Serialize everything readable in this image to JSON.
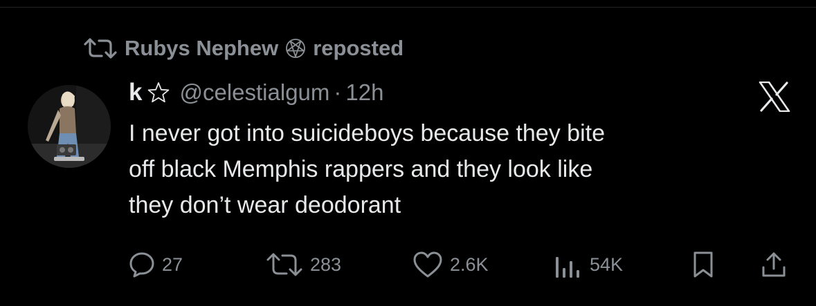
{
  "repost": {
    "reposter": "Rubys Nephew",
    "label": "reposted"
  },
  "tweet": {
    "display_name": "k",
    "handle": "@celestialgum",
    "separator": "·",
    "time": "12h",
    "lines": [
      "I never got into suicideboys because they bite",
      "off black Memphis rappers and they look like",
      "they don’t wear deodorant"
    ]
  },
  "actions": {
    "replies": "27",
    "reposts": "283",
    "likes": "2.6K",
    "views": "54K"
  },
  "icons": {
    "repost_indicator": "repost-icon",
    "pentagram": "inverted-pentagram-icon",
    "name_badge": "star-outline-icon",
    "brand": "x-logo-icon",
    "reply": "reply-bubble-icon",
    "retweet": "retweet-icon",
    "like": "heart-icon",
    "views": "bar-chart-icon",
    "bookmark": "bookmark-icon",
    "share": "share-icon"
  },
  "colors": {
    "background": "#000000",
    "text_primary": "#e7e9ea",
    "text_secondary": "#8b9096"
  }
}
